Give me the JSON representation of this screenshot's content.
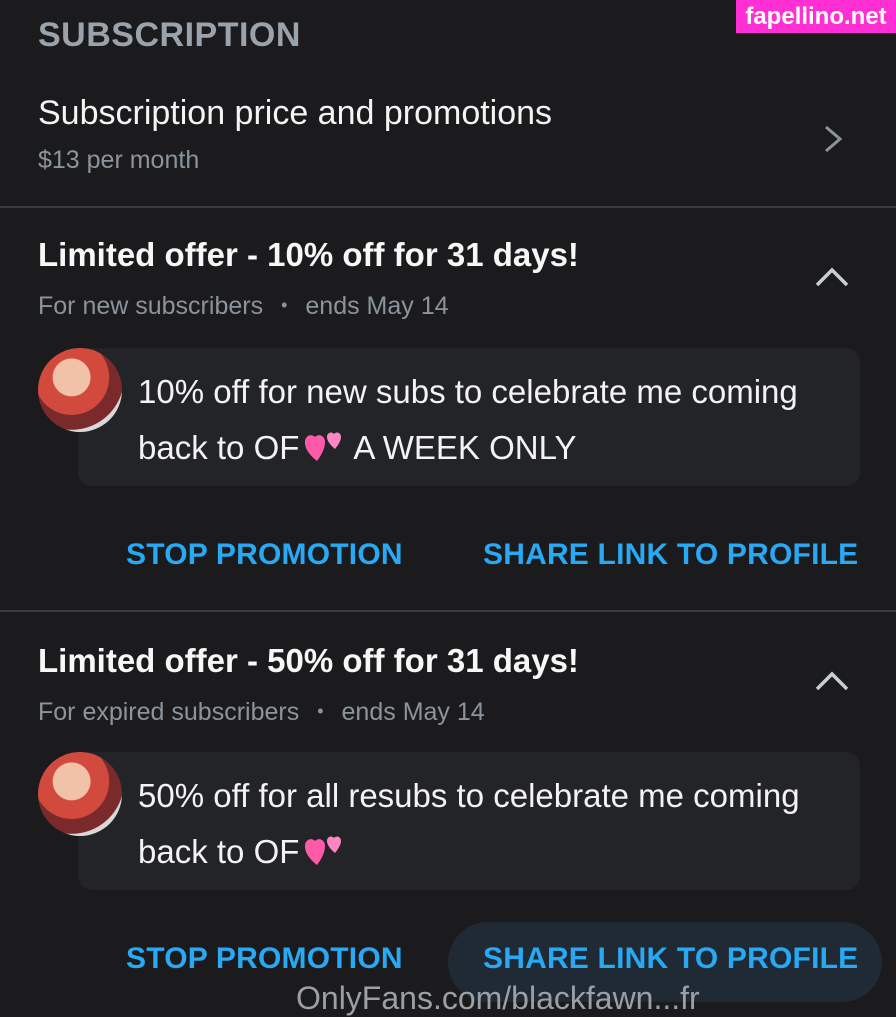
{
  "watermark": "fapellino.net",
  "section_title": "SUBSCRIPTION",
  "price": {
    "title": "Subscription price and promotions",
    "subtitle": "$13 per month"
  },
  "offers": [
    {
      "title": "Limited offer - 10% off for 31 days!",
      "audience": "For new subscribers",
      "ends": "ends May 14",
      "message_part1": "10% off for new subs to celebrate me coming back to OF",
      "message_part2": "A WEEK ONLY",
      "stop_label": "STOP PROMOTION",
      "share_label": "SHARE LINK TO PROFILE"
    },
    {
      "title": "Limited offer - 50% off for 31 days!",
      "audience": "For expired subscribers",
      "ends": "ends May 14",
      "message_part1": "50% off for all resubs to celebrate me coming back to OF",
      "message_part2": "",
      "stop_label": "STOP PROMOTION",
      "share_label": "SHARE LINK TO PROFILE"
    }
  ],
  "footer_partial": "OnlyFans.com/blackfawn...fr",
  "colors": {
    "background": "#1b1b1d",
    "accent": "#29a8f3",
    "muted": "#8b949c",
    "watermark": "#ff2fd3"
  },
  "icons": [
    "chevron-right-icon",
    "chevron-up-icon",
    "two-hearts-icon"
  ]
}
